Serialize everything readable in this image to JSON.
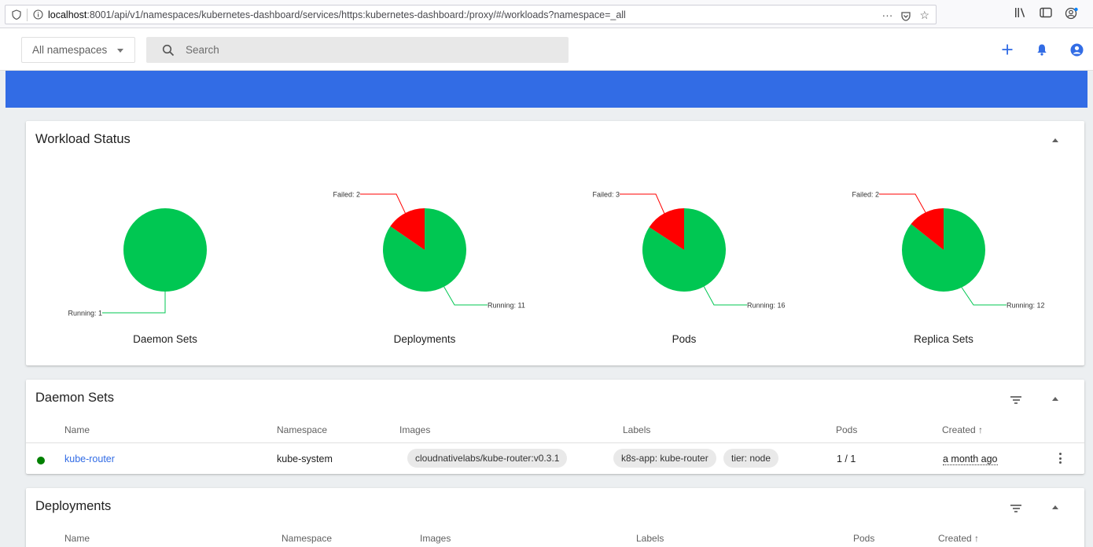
{
  "browser": {
    "url_host": "localhost",
    "url_rest": ":8001/api/v1/namespaces/kubernetes-dashboard/services/https:kubernetes-dashboard:/proxy/#/workloads?namespace=_all",
    "page_actions": "···"
  },
  "toolbar": {
    "namespace_selector": "All namespaces",
    "search_placeholder": "Search"
  },
  "workload_status": {
    "title": "Workload Status",
    "charts": [
      {
        "name": "Daemon Sets",
        "running": 1,
        "failed": 0,
        "running_label": "Running: 1",
        "failed_label": ""
      },
      {
        "name": "Deployments",
        "running": 11,
        "failed": 2,
        "running_label": "Running: 11",
        "failed_label": "Failed: 2"
      },
      {
        "name": "Pods",
        "running": 16,
        "failed": 3,
        "running_label": "Running: 16",
        "failed_label": "Failed: 3"
      },
      {
        "name": "Replica Sets",
        "running": 12,
        "failed": 2,
        "running_label": "Running: 12",
        "failed_label": "Failed: 2"
      }
    ],
    "colors": {
      "running": "#00c752",
      "failed": "#ff0000"
    }
  },
  "daemon_sets": {
    "title": "Daemon Sets",
    "columns": {
      "name": "Name",
      "namespace": "Namespace",
      "images": "Images",
      "labels": "Labels",
      "pods": "Pods",
      "created": "Created ↑"
    },
    "rows": [
      {
        "name": "kube-router",
        "namespace": "kube-system",
        "image": "cloudnativelabs/kube-router:v0.3.1",
        "labels": [
          "k8s-app: kube-router",
          "tier: node"
        ],
        "pods": "1 / 1",
        "created": "a month ago",
        "status_color": "#008000"
      }
    ]
  },
  "deployments": {
    "title": "Deployments",
    "columns": {
      "name": "Name",
      "namespace": "Namespace",
      "images": "Images",
      "labels": "Labels",
      "pods": "Pods",
      "created": "Created ↑"
    }
  },
  "chart_data": [
    {
      "type": "pie",
      "title": "Daemon Sets",
      "labels": [
        "Running"
      ],
      "values": [
        1
      ]
    },
    {
      "type": "pie",
      "title": "Deployments",
      "labels": [
        "Running",
        "Failed"
      ],
      "values": [
        11,
        2
      ]
    },
    {
      "type": "pie",
      "title": "Pods",
      "labels": [
        "Running",
        "Failed"
      ],
      "values": [
        16,
        3
      ]
    },
    {
      "type": "pie",
      "title": "Replica Sets",
      "labels": [
        "Running",
        "Failed"
      ],
      "values": [
        12,
        2
      ]
    }
  ]
}
